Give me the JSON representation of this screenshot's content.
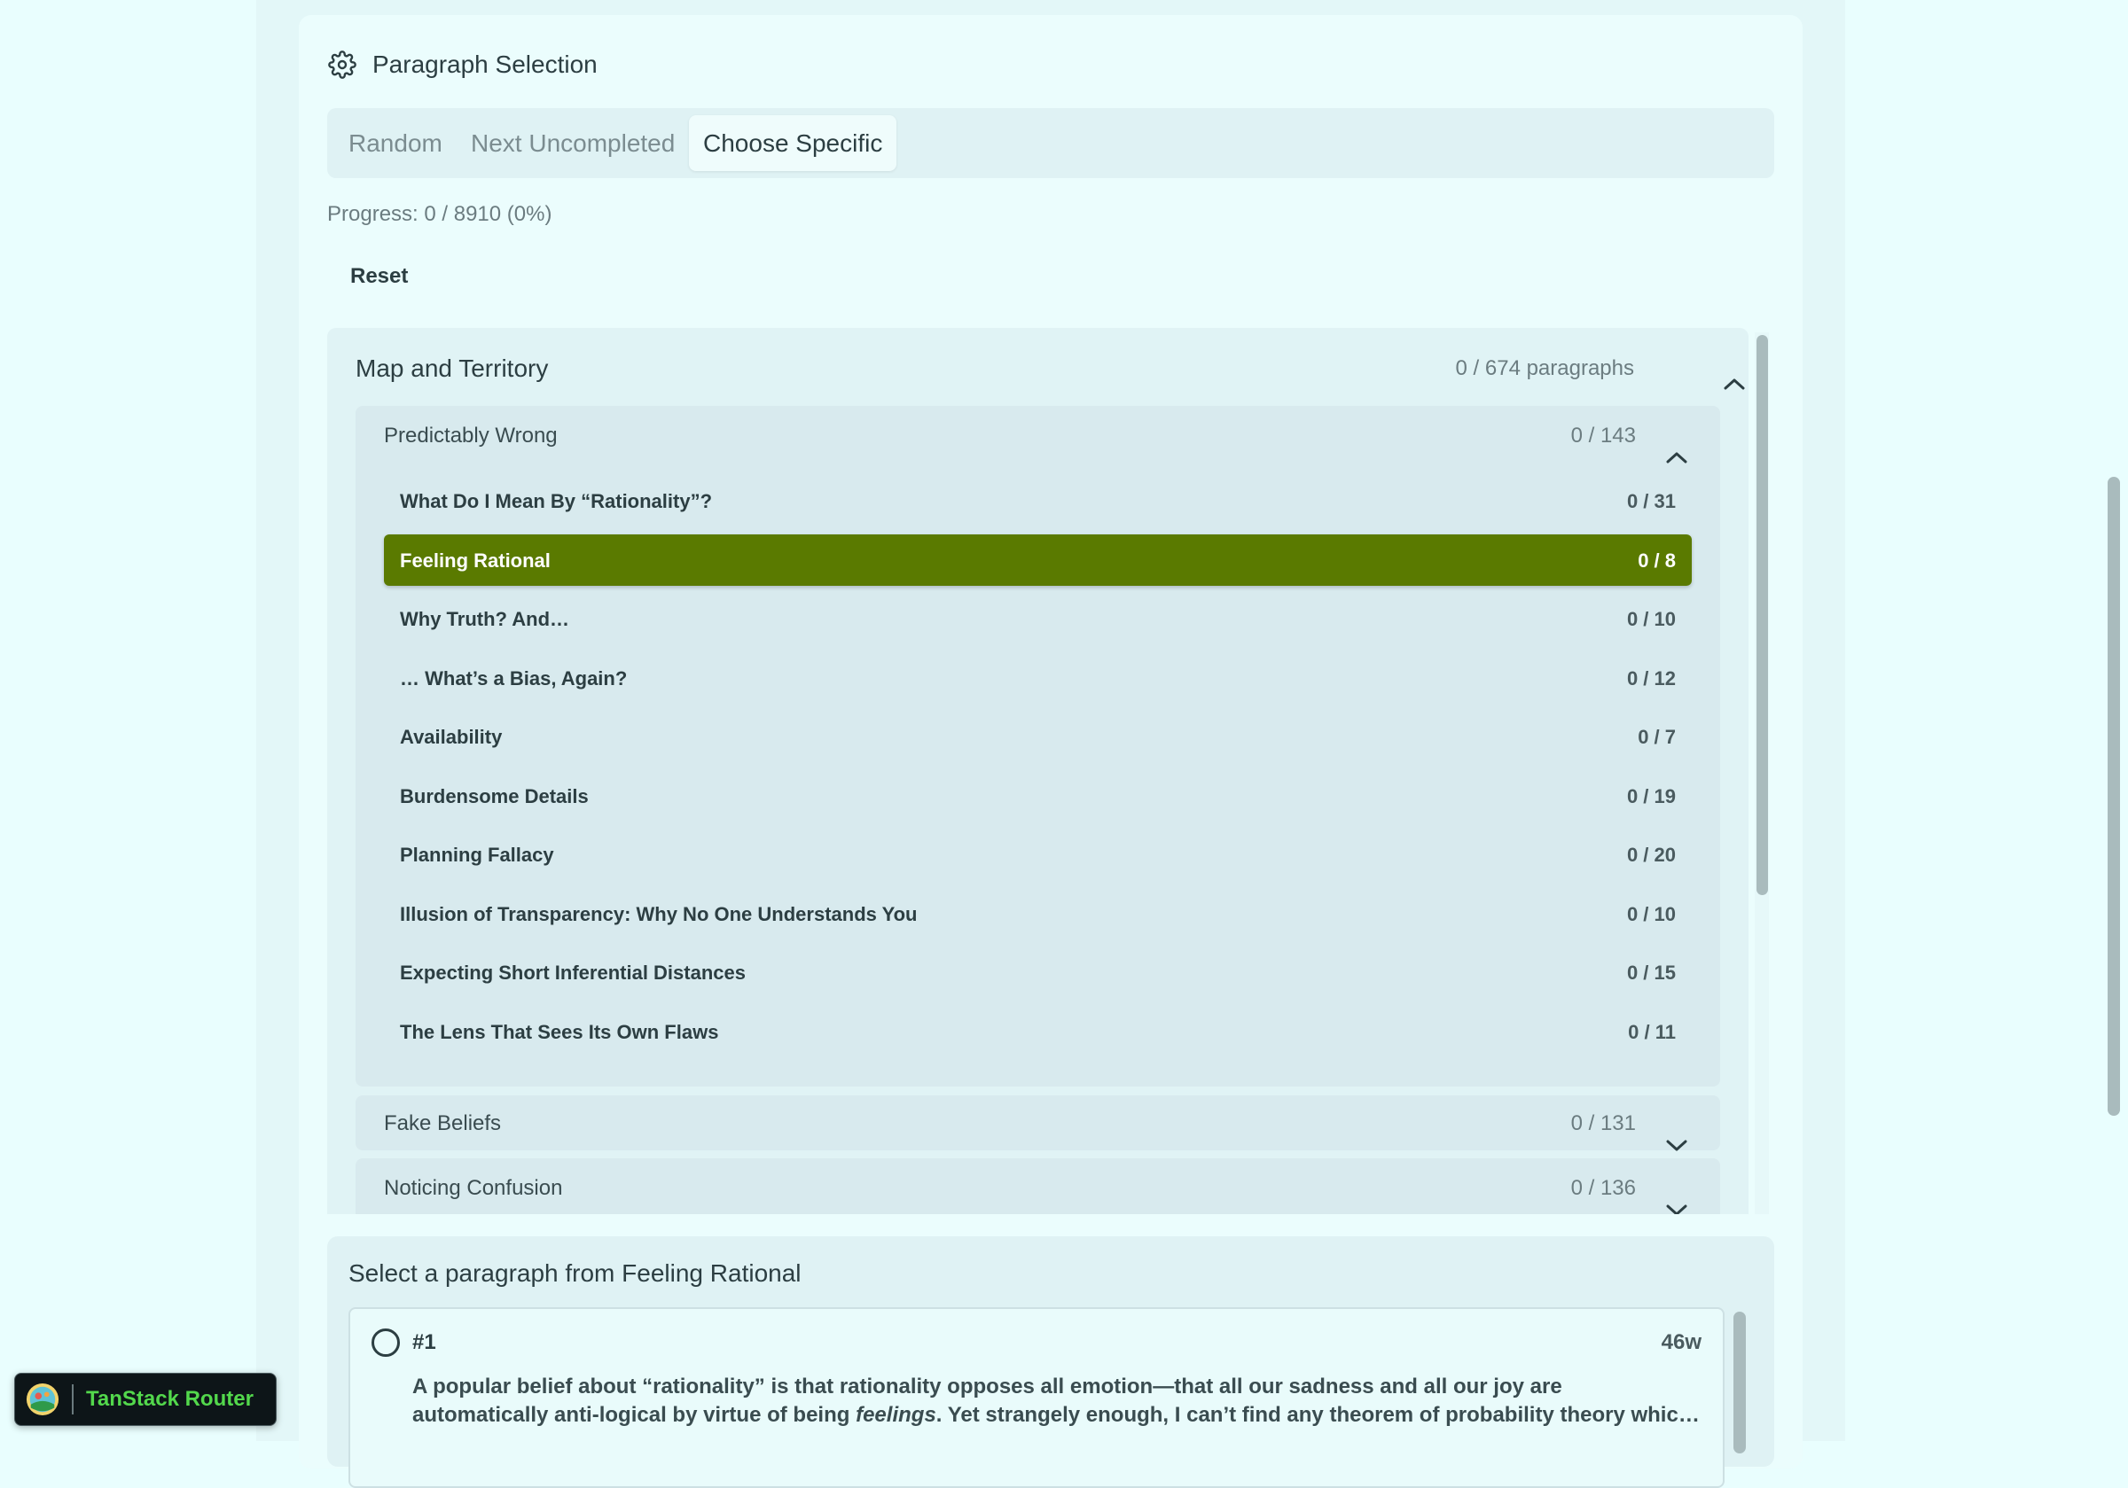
{
  "header": {
    "title": "Paragraph Selection",
    "icon": "gear-icon"
  },
  "tabs": [
    {
      "label": "Random",
      "active": false
    },
    {
      "label": "Next Uncompleted",
      "active": false
    },
    {
      "label": "Choose Specific",
      "active": true
    }
  ],
  "progress_text": "Progress: 0 / 8910 (0%)",
  "reset_label": "Reset",
  "book": {
    "title": "Map and Territory",
    "count": "0 / 674 paragraphs",
    "sequences": [
      {
        "title": "Predictably Wrong",
        "count": "0 / 143",
        "expanded": true,
        "posts": [
          {
            "title": "What Do I Mean By “Rationality”?",
            "count": "0 / 31"
          },
          {
            "title": "Feeling Rational",
            "count": "0 / 8",
            "selected": true
          },
          {
            "title": "Why Truth? And…",
            "count": "0 / 10"
          },
          {
            "title": "… What’s a Bias, Again?",
            "count": "0 / 12"
          },
          {
            "title": "Availability",
            "count": "0 / 7"
          },
          {
            "title": "Burdensome Details",
            "count": "0 / 19"
          },
          {
            "title": "Planning Fallacy",
            "count": "0 / 20"
          },
          {
            "title": "Illusion of Transparency: Why No One Understands You",
            "count": "0 / 10"
          },
          {
            "title": "Expecting Short Inferential Distances",
            "count": "0 / 15"
          },
          {
            "title": "The Lens That Sees Its Own Flaws",
            "count": "0 / 11"
          }
        ]
      },
      {
        "title": "Fake Beliefs",
        "count": "0 / 131",
        "expanded": false
      },
      {
        "title": "Noticing Confusion",
        "count": "0 / 136",
        "expanded": false
      }
    ]
  },
  "paragraph_select": {
    "title": "Select a paragraph from Feeling Rational",
    "items": [
      {
        "number": "#1",
        "words": "46w",
        "text_line1": "A popular belief about “rationality” is that rationality opposes all emotion—that all our sadness and all our joy are",
        "text_line2_pre": "automatically anti-logical by virtue of being ",
        "text_line2_em": "feelings",
        "text_line2_post": ". Yet strangely enough, I can’t find any theorem of probability theory whic…"
      }
    ]
  },
  "devtools": {
    "label": "TanStack Router"
  },
  "colors": {
    "selected_post_bg": "#5a7a00",
    "page_bg": "#e9fefe",
    "devtools_label": "#53d84c"
  }
}
